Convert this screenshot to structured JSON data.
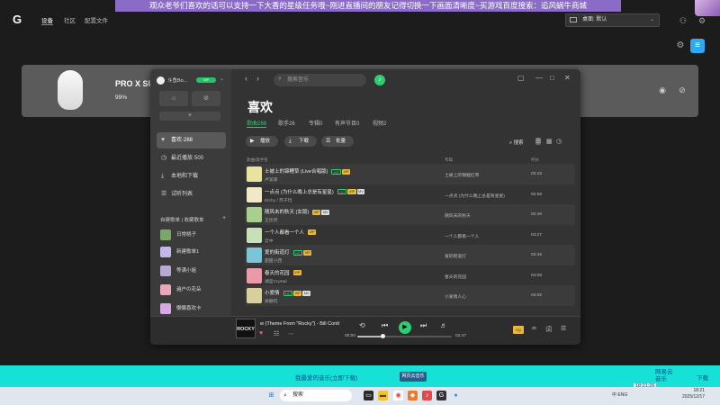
{
  "overlay": {
    "banner": "观众老爷们喜欢的话可以支持一下大香的星级任务哦~刚进直播间的朋友记得切换一下画面清晰度~买游戏百度搜索：追风蜗牛商城"
  },
  "ghub": {
    "logo": "G",
    "nav": [
      "设备",
      "社区",
      "配置文件"
    ],
    "profile_select": "桌面: 默认",
    "device_name": "PRO X SU",
    "battery": "99%"
  },
  "music": {
    "user_name": "斗鱼Bo...",
    "vip_label": "VIP",
    "sidebar_items": [
      {
        "icon": "heart-icon",
        "label": "喜欢·288"
      },
      {
        "icon": "clock-icon",
        "label": "最近播放·500"
      },
      {
        "icon": "download-icon",
        "label": "本地和下载"
      },
      {
        "icon": "listen-list-icon",
        "label": "试听列表"
      }
    ],
    "playlists_header": "自建歌单 | 收藏歌单",
    "playlists": [
      "日常桃子",
      "新建歌单1",
      "等满小姐",
      "遍户の花朵",
      "懒懒喜欢卡"
    ],
    "search_placeholder": "搜索音乐",
    "page_title": "喜欢",
    "tabs": [
      "歌曲288",
      "歌手26",
      "专辑0",
      "有声节目0",
      "视频2"
    ],
    "actions": {
      "play": "播放",
      "download": "下载",
      "batch": "批量"
    },
    "list_search": "搜索",
    "columns": {
      "title": "歌曲/歌手名",
      "album": "专辑",
      "duration": "时长"
    },
    "songs": [
      {
        "title": "士被上的锦鲤草 (Live合唱版)",
        "artist": "卢润泽",
        "album": "士被上的锦鲤红草",
        "duration": "03:15",
        "badges": [
          "HQ",
          "VIP"
        ],
        "cover": "#e8e4a0"
      },
      {
        "title": "一点点 (为什么晚上总是有星星)",
        "artist": "Etchy / 苏子玩",
        "album": "一点点 (为什么晚上总是有星星)",
        "duration": "02:58",
        "badges": [
          "HQ",
          "VIP",
          "MV"
        ],
        "cover": "#f0e8c8"
      },
      {
        "title": "随风未的秋天 (女版)",
        "artist": "王优然",
        "album": "随风未的秋天",
        "duration": "02:46",
        "badges": [
          "VIP",
          "MV"
        ],
        "cover": "#a9cf8e"
      },
      {
        "title": "一个人都看一个人",
        "artist": "云中",
        "album": "一个人都看一个人",
        "duration": "03:27",
        "badges": [
          "VIP"
        ],
        "cover": "#c8e0b8"
      },
      {
        "title": "爱的街道灯",
        "artist": "甜甜小西",
        "album": "爱的街道灯",
        "duration": "03:45",
        "badges": [
          "HQ",
          "VIP"
        ],
        "cover": "#7cc4d8"
      },
      {
        "title": "春天的花园",
        "artist": "湖蓝Crystal",
        "album": "春天的花园",
        "duration": "04:05",
        "badges": [
          "VIP"
        ],
        "cover": "#e89aa8"
      },
      {
        "title": "小爱情",
        "artist": "梁静钧",
        "album": "小爱情人心",
        "duration": "04:05",
        "badges": [
          "HQ",
          "VIP",
          "MV"
        ],
        "cover": "#d8cfa0"
      }
    ],
    "player": {
      "cover_text": "ROCKY",
      "title": "w (Theme From \"Rocky\") - Bill Conti",
      "current_time": "00:00",
      "total_time": "02:47",
      "progress": 0.27,
      "quality": "SQ"
    }
  },
  "cyan_bar": {
    "text": "我最爱的音乐(立即下载)",
    "button": "网页云音乐",
    "right1": "网易云\n音乐",
    "right2": "下载",
    "corner": "18:21:26"
  },
  "taskbar": {
    "search": "搜索",
    "tray": "中 ENG",
    "clock": "18:21\n2025/12/17"
  }
}
